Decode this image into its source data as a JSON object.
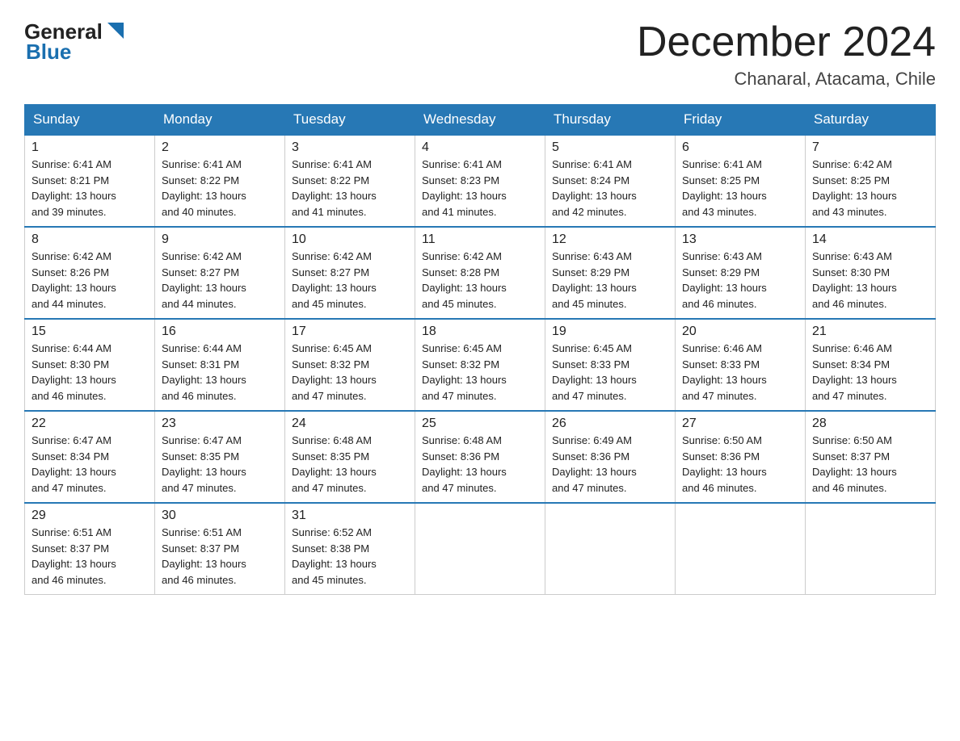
{
  "logo": {
    "text_general": "General",
    "triangle_color": "#1a6faf",
    "text_blue": "Blue"
  },
  "header": {
    "month_title": "December 2024",
    "location": "Chanaral, Atacama, Chile"
  },
  "weekdays": [
    "Sunday",
    "Monday",
    "Tuesday",
    "Wednesday",
    "Thursday",
    "Friday",
    "Saturday"
  ],
  "weeks": [
    [
      {
        "day": "1",
        "sunrise": "6:41 AM",
        "sunset": "8:21 PM",
        "daylight": "13 hours and 39 minutes."
      },
      {
        "day": "2",
        "sunrise": "6:41 AM",
        "sunset": "8:22 PM",
        "daylight": "13 hours and 40 minutes."
      },
      {
        "day": "3",
        "sunrise": "6:41 AM",
        "sunset": "8:22 PM",
        "daylight": "13 hours and 41 minutes."
      },
      {
        "day": "4",
        "sunrise": "6:41 AM",
        "sunset": "8:23 PM",
        "daylight": "13 hours and 41 minutes."
      },
      {
        "day": "5",
        "sunrise": "6:41 AM",
        "sunset": "8:24 PM",
        "daylight": "13 hours and 42 minutes."
      },
      {
        "day": "6",
        "sunrise": "6:41 AM",
        "sunset": "8:25 PM",
        "daylight": "13 hours and 43 minutes."
      },
      {
        "day": "7",
        "sunrise": "6:42 AM",
        "sunset": "8:25 PM",
        "daylight": "13 hours and 43 minutes."
      }
    ],
    [
      {
        "day": "8",
        "sunrise": "6:42 AM",
        "sunset": "8:26 PM",
        "daylight": "13 hours and 44 minutes."
      },
      {
        "day": "9",
        "sunrise": "6:42 AM",
        "sunset": "8:27 PM",
        "daylight": "13 hours and 44 minutes."
      },
      {
        "day": "10",
        "sunrise": "6:42 AM",
        "sunset": "8:27 PM",
        "daylight": "13 hours and 45 minutes."
      },
      {
        "day": "11",
        "sunrise": "6:42 AM",
        "sunset": "8:28 PM",
        "daylight": "13 hours and 45 minutes."
      },
      {
        "day": "12",
        "sunrise": "6:43 AM",
        "sunset": "8:29 PM",
        "daylight": "13 hours and 45 minutes."
      },
      {
        "day": "13",
        "sunrise": "6:43 AM",
        "sunset": "8:29 PM",
        "daylight": "13 hours and 46 minutes."
      },
      {
        "day": "14",
        "sunrise": "6:43 AM",
        "sunset": "8:30 PM",
        "daylight": "13 hours and 46 minutes."
      }
    ],
    [
      {
        "day": "15",
        "sunrise": "6:44 AM",
        "sunset": "8:30 PM",
        "daylight": "13 hours and 46 minutes."
      },
      {
        "day": "16",
        "sunrise": "6:44 AM",
        "sunset": "8:31 PM",
        "daylight": "13 hours and 46 minutes."
      },
      {
        "day": "17",
        "sunrise": "6:45 AM",
        "sunset": "8:32 PM",
        "daylight": "13 hours and 47 minutes."
      },
      {
        "day": "18",
        "sunrise": "6:45 AM",
        "sunset": "8:32 PM",
        "daylight": "13 hours and 47 minutes."
      },
      {
        "day": "19",
        "sunrise": "6:45 AM",
        "sunset": "8:33 PM",
        "daylight": "13 hours and 47 minutes."
      },
      {
        "day": "20",
        "sunrise": "6:46 AM",
        "sunset": "8:33 PM",
        "daylight": "13 hours and 47 minutes."
      },
      {
        "day": "21",
        "sunrise": "6:46 AM",
        "sunset": "8:34 PM",
        "daylight": "13 hours and 47 minutes."
      }
    ],
    [
      {
        "day": "22",
        "sunrise": "6:47 AM",
        "sunset": "8:34 PM",
        "daylight": "13 hours and 47 minutes."
      },
      {
        "day": "23",
        "sunrise": "6:47 AM",
        "sunset": "8:35 PM",
        "daylight": "13 hours and 47 minutes."
      },
      {
        "day": "24",
        "sunrise": "6:48 AM",
        "sunset": "8:35 PM",
        "daylight": "13 hours and 47 minutes."
      },
      {
        "day": "25",
        "sunrise": "6:48 AM",
        "sunset": "8:36 PM",
        "daylight": "13 hours and 47 minutes."
      },
      {
        "day": "26",
        "sunrise": "6:49 AM",
        "sunset": "8:36 PM",
        "daylight": "13 hours and 47 minutes."
      },
      {
        "day": "27",
        "sunrise": "6:50 AM",
        "sunset": "8:36 PM",
        "daylight": "13 hours and 46 minutes."
      },
      {
        "day": "28",
        "sunrise": "6:50 AM",
        "sunset": "8:37 PM",
        "daylight": "13 hours and 46 minutes."
      }
    ],
    [
      {
        "day": "29",
        "sunrise": "6:51 AM",
        "sunset": "8:37 PM",
        "daylight": "13 hours and 46 minutes."
      },
      {
        "day": "30",
        "sunrise": "6:51 AM",
        "sunset": "8:37 PM",
        "daylight": "13 hours and 46 minutes."
      },
      {
        "day": "31",
        "sunrise": "6:52 AM",
        "sunset": "8:38 PM",
        "daylight": "13 hours and 45 minutes."
      },
      null,
      null,
      null,
      null
    ]
  ],
  "labels": {
    "sunrise": "Sunrise:",
    "sunset": "Sunset:",
    "daylight": "Daylight:"
  }
}
